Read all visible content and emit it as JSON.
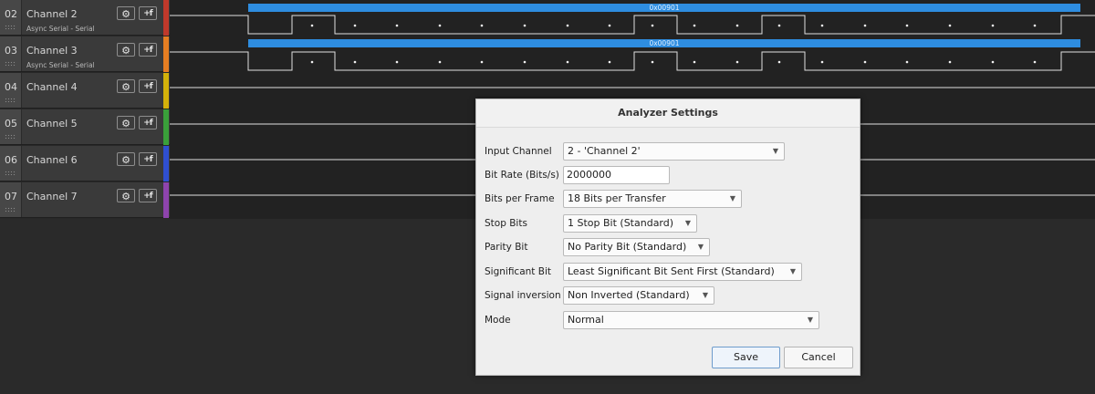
{
  "channels": [
    {
      "num": "02",
      "name": "Channel 2",
      "sub": "Async Serial - Serial",
      "color": "#c0392b"
    },
    {
      "num": "03",
      "name": "Channel 3",
      "sub": "Async Serial - Serial",
      "color": "#e67e22"
    },
    {
      "num": "04",
      "name": "Channel 4",
      "sub": "",
      "color": "#d4b20a"
    },
    {
      "num": "05",
      "name": "Channel 5",
      "sub": "",
      "color": "#3aa03a"
    },
    {
      "num": "06",
      "name": "Channel 6",
      "sub": "",
      "color": "#2f4fd0"
    },
    {
      "num": "07",
      "name": "Channel 7",
      "sub": "",
      "color": "#8e44ad"
    }
  ],
  "channel_buttons": {
    "gear_glyph": "⚙",
    "trigger_glyph": "+f"
  },
  "waveforms": {
    "frame_label_1": "0x00901",
    "frame_label_2": "0x00901",
    "bar_color": "#2e8de0",
    "signal_color": "#e0e0e0"
  },
  "dialog": {
    "title": "Analyzer Settings",
    "fields": [
      {
        "label": "Input Channel",
        "value": "2 - 'Channel 2'"
      },
      {
        "label": "Bit Rate (Bits/s)",
        "value": "2000000"
      },
      {
        "label": "Bits per Frame",
        "value": "18 Bits per Transfer"
      },
      {
        "label": "Stop Bits",
        "value": "1 Stop Bit (Standard)"
      },
      {
        "label": "Parity Bit",
        "value": "No Parity Bit (Standard)"
      },
      {
        "label": "Significant Bit",
        "value": "Least Significant Bit Sent First (Standard)"
      },
      {
        "label": "Signal inversion",
        "value": "Non Inverted (Standard)"
      },
      {
        "label": "Mode",
        "value": "Normal"
      }
    ],
    "save_label": "Save",
    "cancel_label": "Cancel",
    "dropdown_glyph": "▼"
  }
}
